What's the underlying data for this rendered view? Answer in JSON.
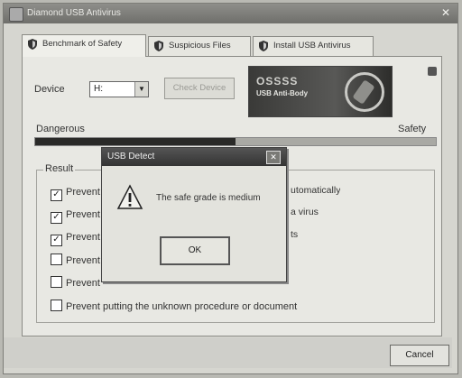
{
  "window": {
    "title": "Diamond USB Antivirus"
  },
  "tabs": [
    {
      "label": "Benchmark of Safety",
      "icon": "shield-icon"
    },
    {
      "label": "Suspicious Files",
      "icon": "shield-icon"
    },
    {
      "label": "Install USB Antivirus",
      "icon": "shield-icon"
    }
  ],
  "device": {
    "label": "Device",
    "value": "H:",
    "check_label": "Check Device"
  },
  "banner": {
    "line1": "OSSSS",
    "line2": "USB Anti-Body"
  },
  "safety": {
    "left_label": "Dangerous",
    "right_label": "Safety",
    "level": 0.5
  },
  "result": {
    "label": "Result",
    "items": [
      {
        "left": "Prevent",
        "right": "utomatically",
        "checked": true
      },
      {
        "left": "Prevent",
        "right": "a virus",
        "checked": true
      },
      {
        "left": "Prevent",
        "right": "ts",
        "checked": true
      },
      {
        "left": "Prevent",
        "right": "",
        "checked": false
      },
      {
        "left": "Prevent",
        "right": "",
        "checked": false
      },
      {
        "text": "Prevent putting the unknown procedure or document",
        "checked": false
      }
    ]
  },
  "footer": {
    "cancel_label": "Cancel"
  },
  "dialog": {
    "title": "USB Detect",
    "message": "The safe grade is medium",
    "ok_label": "OK",
    "icon": "warning-icon"
  },
  "colors": {
    "title_bar": "#7a7a76",
    "dialog_title": "#3f3f3d",
    "safety_fill": "#2a2a28"
  }
}
